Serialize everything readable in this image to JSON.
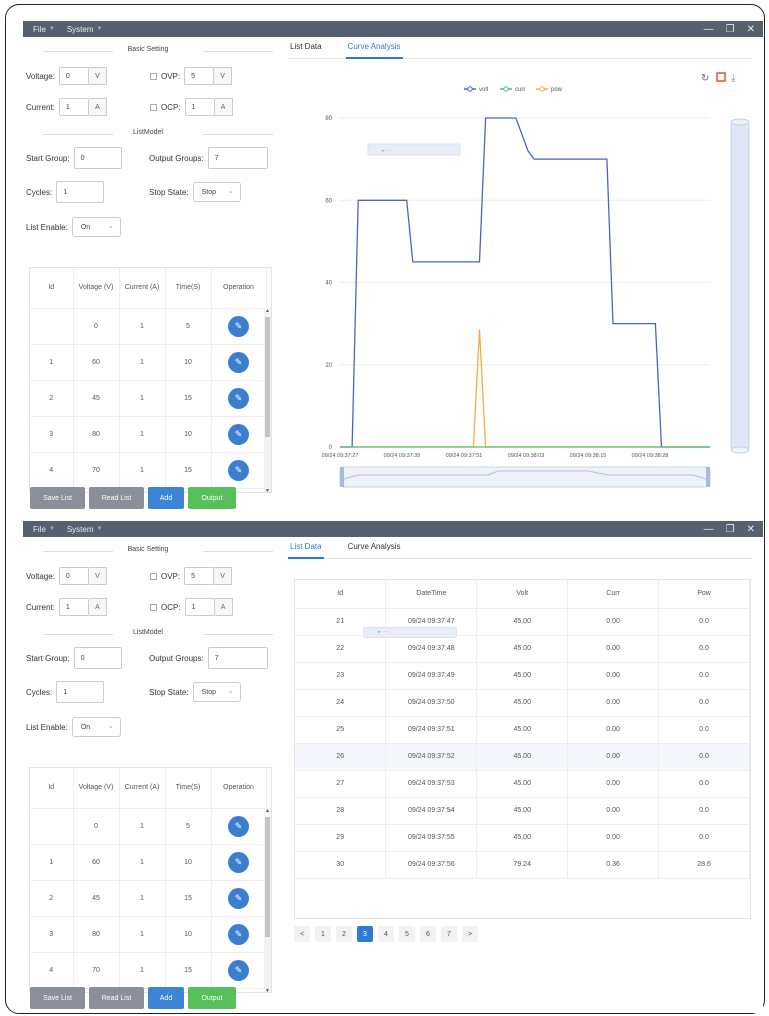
{
  "menu": {
    "file": "File",
    "system": "System"
  },
  "winctrl": {
    "min": "—",
    "restore": "❐",
    "close": "✕"
  },
  "left": {
    "basic_setting": "Basic Setting",
    "voltage_label": "Voltage:",
    "voltage_value": "0",
    "voltage_unit": "V",
    "ovp_label": "OVP:",
    "ovp_value": "5",
    "ovp_unit": "V",
    "current_label": "Current:",
    "current_value": "1",
    "current_unit": "A",
    "ocp_label": "OCP:",
    "ocp_value": "1",
    "ocp_unit": "A",
    "list_model": "ListModel",
    "start_group_label": "Start Group:",
    "start_group_value": "0",
    "output_groups_label": "Output Groups:",
    "output_groups_value": "7",
    "cycles_label": "Cycles:",
    "cycles_value": "1",
    "stop_state_label": "Stop State:",
    "stop_state_value": "Stop",
    "list_enable_label": "List Enable:",
    "list_enable_value": "On",
    "table": {
      "headers": [
        "Id",
        "Voltage (V)",
        "Current (A)",
        "Time(S)",
        "Operation"
      ],
      "rows": [
        [
          "",
          "0",
          "1",
          "5"
        ],
        [
          "1",
          "60",
          "1",
          "10"
        ],
        [
          "2",
          "45",
          "1",
          "15"
        ],
        [
          "3",
          "80",
          "1",
          "10"
        ],
        [
          "4",
          "70",
          "1",
          "15"
        ]
      ]
    },
    "buttons": {
      "save": "Save List",
      "read": "Read List",
      "add": "Add",
      "output": "Output"
    }
  },
  "tabs": {
    "list_data": "List Data",
    "curve_analysis": "Curve Analysis"
  },
  "ghost_label": "▸ ····",
  "chart_data": {
    "type": "line",
    "legend": [
      "volt",
      "curr",
      "pow"
    ],
    "colors": {
      "volt": "#4a63c9",
      "curr": "#5bbf6a",
      "pow": "#f0b040"
    },
    "yticks": [
      "0",
      "20",
      "40",
      "60",
      "80"
    ],
    "ylim": [
      0,
      80
    ],
    "xticks": [
      "09/24 09:37:27",
      "09/24 09:37:39",
      "09/24 09:37:51",
      "09/24 09:38:03",
      "09/24 09:38:15",
      "09/24 09:38:28"
    ],
    "series": [
      {
        "name": "volt",
        "points": [
          [
            0,
            0
          ],
          [
            2,
            0
          ],
          [
            3,
            60
          ],
          [
            11,
            60
          ],
          [
            12,
            45
          ],
          [
            23,
            45
          ],
          [
            24,
            80
          ],
          [
            29,
            80
          ],
          [
            31,
            72
          ],
          [
            32,
            70
          ],
          [
            44,
            70
          ],
          [
            45,
            30
          ],
          [
            52,
            30
          ],
          [
            53,
            0
          ],
          [
            61,
            0
          ]
        ]
      },
      {
        "name": "pow",
        "points": [
          [
            0,
            0
          ],
          [
            22,
            0
          ],
          [
            23,
            28.6
          ],
          [
            24,
            0
          ],
          [
            61,
            0
          ]
        ]
      },
      {
        "name": "curr",
        "points": [
          [
            0,
            0
          ],
          [
            61,
            0
          ]
        ]
      }
    ]
  },
  "list_table": {
    "headers": [
      "Id",
      "DateTime",
      "Volt",
      "Curr",
      "Pow"
    ],
    "rows": [
      [
        "21",
        "09/24 09:37:47",
        "45.00",
        "0.00",
        "0.0"
      ],
      [
        "22",
        "09/24 09:37:48",
        "45.00",
        "0.00",
        "0.0"
      ],
      [
        "23",
        "09/24 09:37:49",
        "45.00",
        "0.00",
        "0.0"
      ],
      [
        "24",
        "09/24 09:37:50",
        "45.00",
        "0.00",
        "0.0"
      ],
      [
        "25",
        "09/24 09:37:51",
        "45.00",
        "0.00",
        "0.0"
      ],
      [
        "26",
        "09/24 09:37:52",
        "45.00",
        "0.00",
        "0.0"
      ],
      [
        "27",
        "09/24 09:37:53",
        "45.00",
        "0.00",
        "0.0"
      ],
      [
        "28",
        "09/24 09:37:54",
        "45.00",
        "0.00",
        "0.0"
      ],
      [
        "29",
        "09/24 09:37:55",
        "45.00",
        "0.00",
        "0.0"
      ],
      [
        "30",
        "09/24 09:37:56",
        "79.24",
        "0.36",
        "28.6"
      ]
    ]
  },
  "pager": {
    "prev": "<",
    "next": ">",
    "pages": [
      "1",
      "2",
      "3",
      "4",
      "5",
      "6",
      "7"
    ],
    "active": "3"
  }
}
